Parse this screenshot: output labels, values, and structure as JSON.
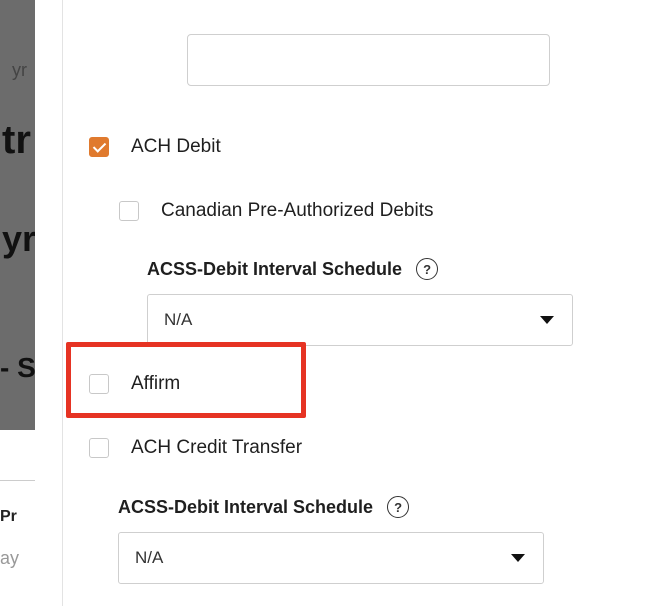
{
  "background_fragments": [
    "yr",
    "tr",
    "yr",
    "- S",
    "Pr",
    "ay"
  ],
  "top_input": {
    "value": "",
    "placeholder": ""
  },
  "payment_methods": [
    {
      "label": "ACH Debit",
      "checked": true
    },
    {
      "label": "Canadian Pre-Authorized Debits",
      "checked": false
    },
    {
      "label": "Affirm",
      "checked": false
    },
    {
      "label": "ACH Credit Transfer",
      "checked": false
    }
  ],
  "interval_schedules": [
    {
      "label": "ACSS-Debit Interval Schedule",
      "help_icon": "?",
      "value": "N/A"
    },
    {
      "label": "ACSS-Debit Interval Schedule",
      "help_icon": "?",
      "value": "N/A"
    }
  ],
  "colors": {
    "accent": "#e07a2e",
    "highlight": "#e63323"
  }
}
